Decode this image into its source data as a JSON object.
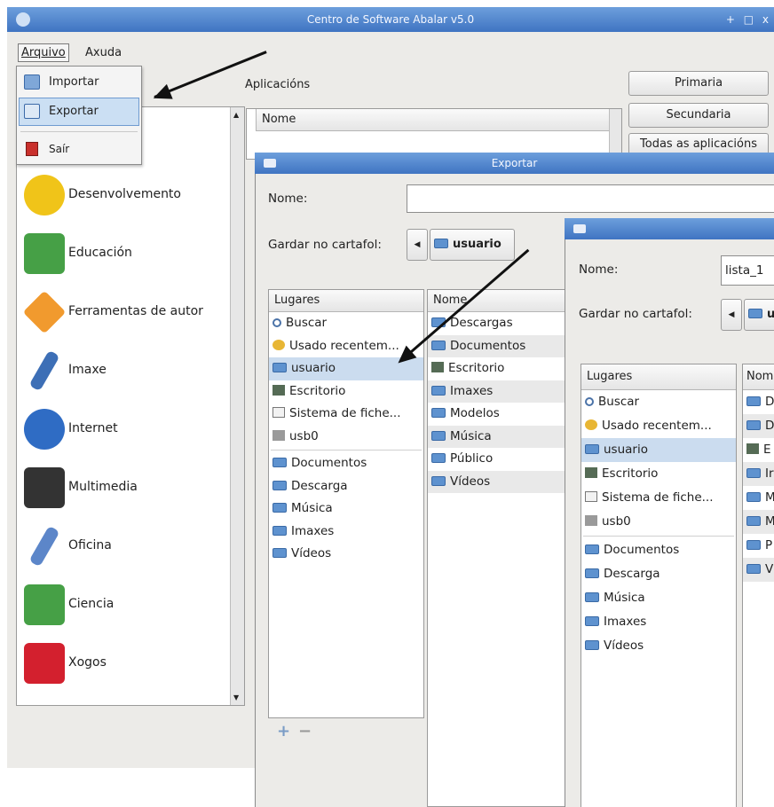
{
  "main_window": {
    "title": "Centro de Software Abalar v5.0",
    "controls": [
      "+",
      "□",
      "x"
    ],
    "menubar": [
      "Arquivo",
      "Axuda"
    ],
    "file_menu": [
      "Importar",
      "Exportar",
      "Saír"
    ],
    "apps_label": "Aplicacións",
    "column_header": "Nome",
    "filter_buttons": [
      "Primaria",
      "Secundaria",
      "Todas as aplicacións"
    ],
    "categories": [
      {
        "label": "Desenvolvemento",
        "icon": "hardhat-icon",
        "color": "#f0c419"
      },
      {
        "label": "Educación",
        "icon": "flask-icon",
        "color": "#46a046"
      },
      {
        "label": "Ferramentas de autor",
        "icon": "diamond-icon",
        "color": "#f19a2e"
      },
      {
        "label": "Imaxe",
        "icon": "paintbrush-icon",
        "color": "#3d6fb6"
      },
      {
        "label": "Internet",
        "icon": "globe-icon",
        "color": "#2f6cc4"
      },
      {
        "label": "Multimedia",
        "icon": "clapperboard-icon",
        "color": "#333333"
      },
      {
        "label": "Oficina",
        "icon": "pen-icon",
        "color": "#5c86c9"
      },
      {
        "label": "Ciencia",
        "icon": "flask-icon",
        "color": "#46a046"
      },
      {
        "label": "Xogos",
        "icon": "cards-icon",
        "color": "#d3202e"
      }
    ]
  },
  "export_dialog": {
    "title": "Exportar",
    "name_label": "Nome:",
    "name_value": "",
    "folder_label": "Gardar no cartafol:",
    "folder_value": "usuario",
    "places_header": "Lugares",
    "files_header": "Nome",
    "places": [
      "Buscar",
      "Usado recentem...",
      "usuario",
      "Escritorio",
      "Sistema de fiche...",
      "usb0"
    ],
    "bookmarks": [
      "Documentos",
      "Descarga",
      "Música",
      "Imaxes",
      "Vídeos"
    ],
    "files": [
      "Descargas",
      "Documentos",
      "Escritorio",
      "Imaxes",
      "Modelos",
      "Música",
      "Público",
      "Vídeos"
    ],
    "add_remove": [
      "+",
      "−"
    ]
  },
  "front_dialog": {
    "name_label": "Nome:",
    "name_value": "lista_1",
    "folder_label": "Gardar no cartafol:",
    "folder_value": "u",
    "places_header": "Lugares",
    "files_header": "Nom",
    "places": [
      "Buscar",
      "Usado recentem...",
      "usuario",
      "Escritorio",
      "Sistema de fiche...",
      "usb0"
    ],
    "bookmarks": [
      "Documentos",
      "Descarga",
      "Música",
      "Imaxes",
      "Vídeos"
    ],
    "files": [
      "D",
      "D",
      "E",
      "Ir",
      "M",
      "M",
      "P",
      "V"
    ]
  }
}
